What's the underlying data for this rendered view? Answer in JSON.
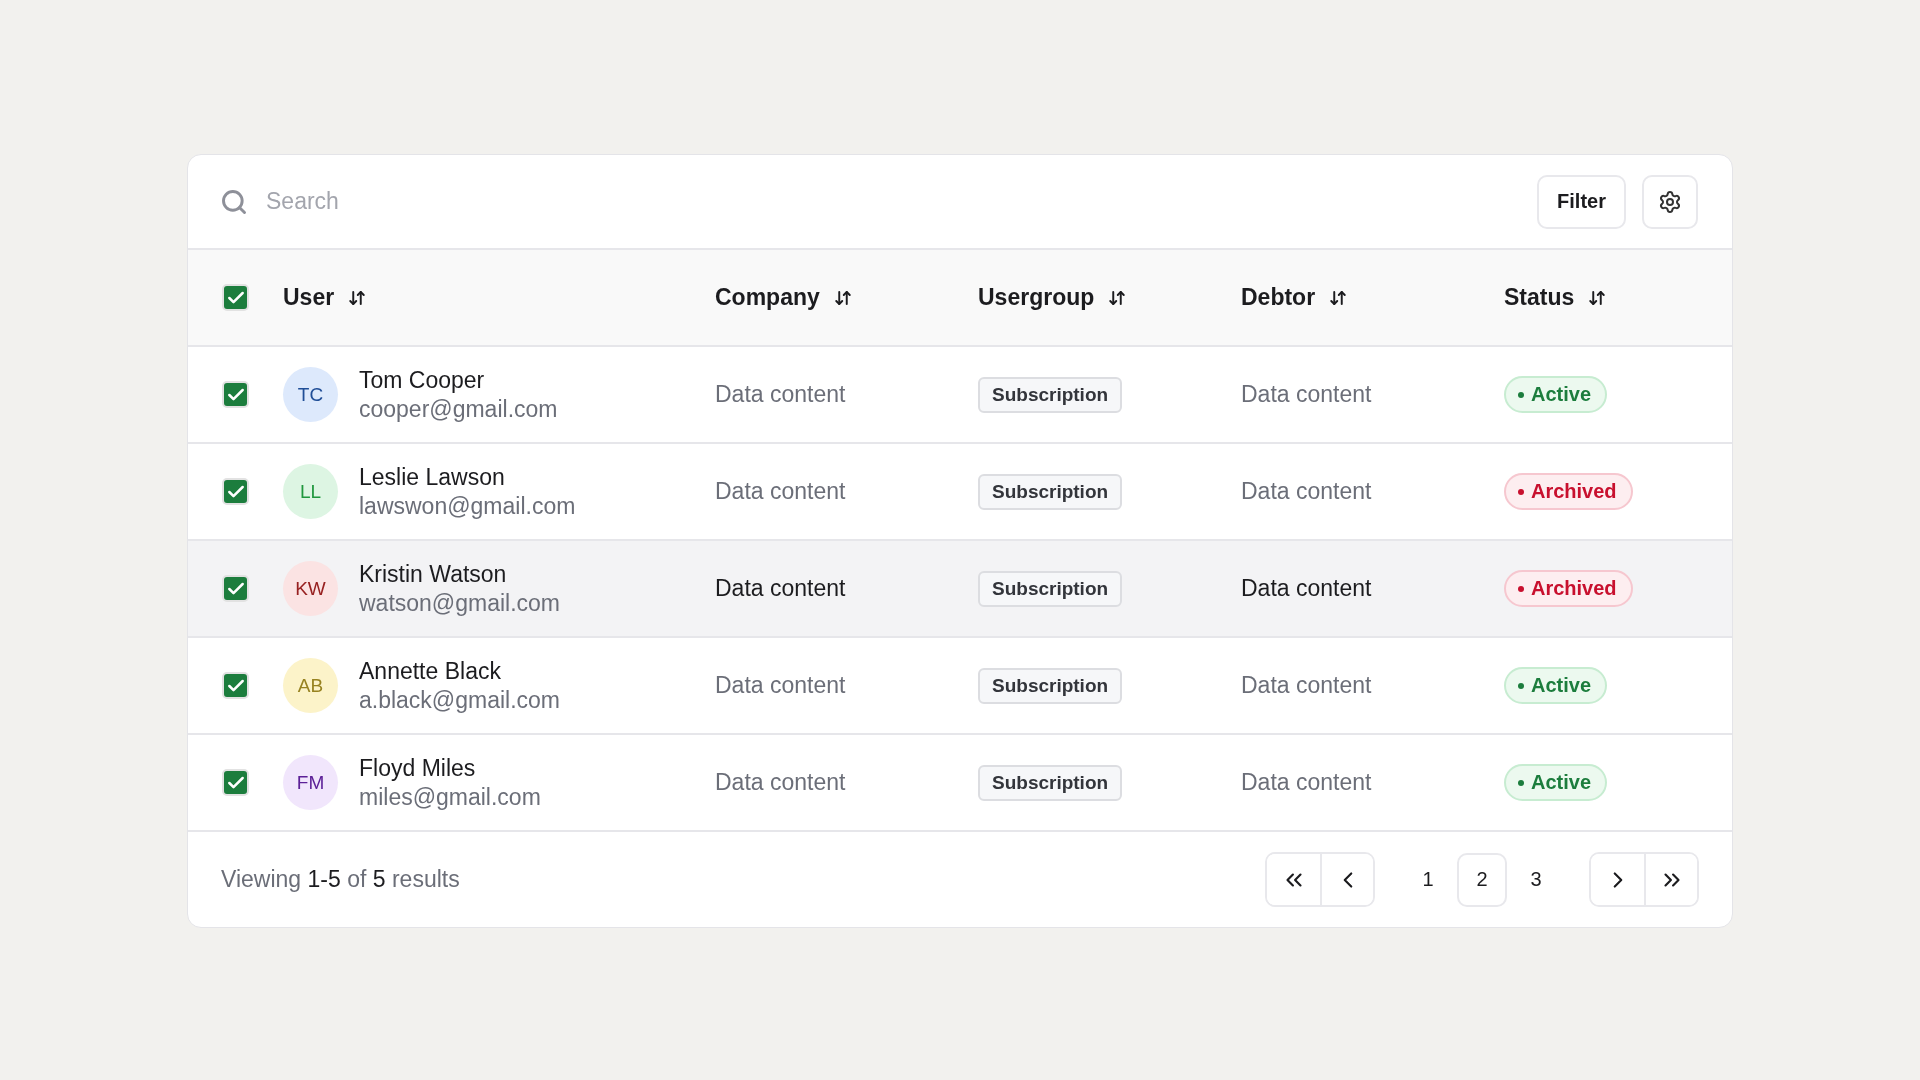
{
  "search": {
    "placeholder": "Search"
  },
  "toolbar": {
    "filter_button": "Filter"
  },
  "table": {
    "select_all": {
      "checked": true
    },
    "columns": [
      {
        "label": "User"
      },
      {
        "label": "Company"
      },
      {
        "label": "Usergroup"
      },
      {
        "label": "Debtor"
      },
      {
        "label": "Status"
      }
    ],
    "rows": [
      {
        "checked": true,
        "highlighted": false,
        "initials": "TC",
        "color": "#dde9fc",
        "name": "Tom Cooper",
        "email": "cooper@gmail.com",
        "company": "Data content",
        "usergroup": "Subscription",
        "debtor": "Data content",
        "status": {
          "kind": "active",
          "label": "Active"
        }
      },
      {
        "checked": true,
        "highlighted": false,
        "initials": "LL",
        "color": "#ddf5e3",
        "name": "Leslie Lawson",
        "email": "lawswon@gmail.com",
        "company": "Data content",
        "usergroup": "Subscription",
        "debtor": "Data content",
        "status": {
          "kind": "archived",
          "label": "Archived"
        }
      },
      {
        "checked": true,
        "highlighted": true,
        "initials": "KW",
        "color": "#fbe3e3",
        "name": "Kristin Watson",
        "email": "watson@gmail.com",
        "company": "Data content",
        "usergroup": "Subscription",
        "debtor": "Data content",
        "status": {
          "kind": "archived",
          "label": "Archived"
        }
      },
      {
        "checked": true,
        "highlighted": false,
        "initials": "AB",
        "color": "#fcf3c9",
        "name": "Annette Black",
        "email": "a.black@gmail.com",
        "company": "Data content",
        "usergroup": "Subscription",
        "debtor": "Data content",
        "status": {
          "kind": "active",
          "label": "Active"
        }
      },
      {
        "checked": true,
        "highlighted": false,
        "initials": "FM",
        "color": "#f1e6fc",
        "name": "Floyd Miles",
        "email": "miles@gmail.com",
        "company": "Data content",
        "usergroup": "Subscription",
        "debtor": "Data content",
        "status": {
          "kind": "active",
          "label": "Active"
        }
      }
    ]
  },
  "footer": {
    "summary": "Viewing **1-5** of **5** results",
    "pages": [
      {
        "label": "1",
        "selected": false
      },
      {
        "label": "2",
        "selected": true
      },
      {
        "label": "3",
        "selected": false
      }
    ]
  }
}
